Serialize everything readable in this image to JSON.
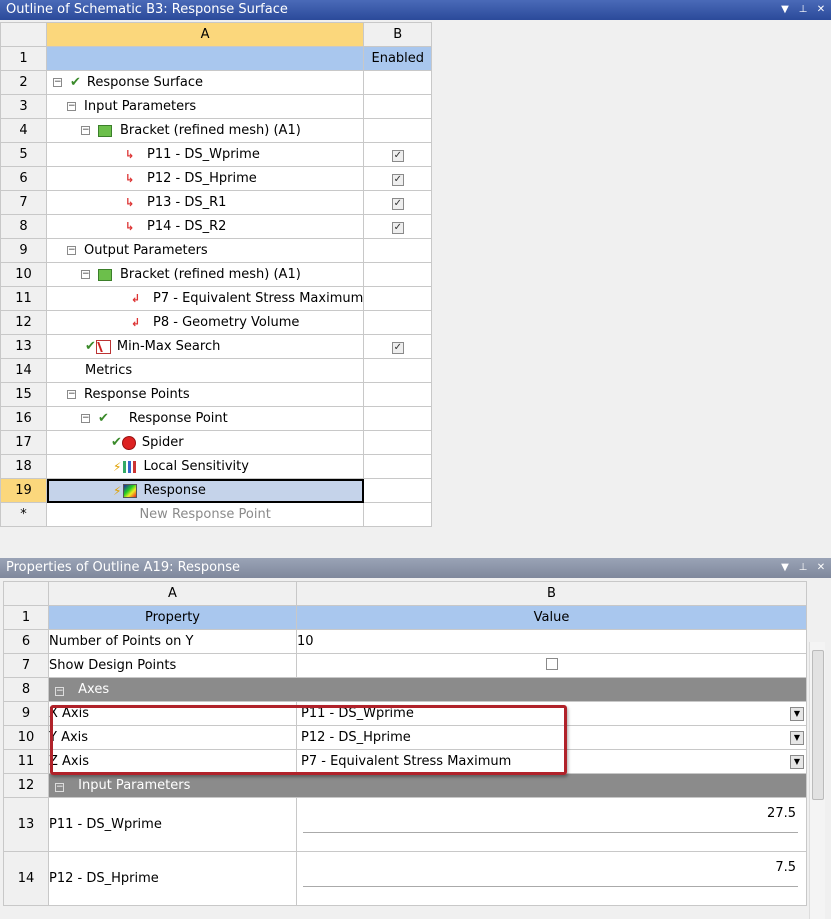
{
  "outline_panel": {
    "title": "Outline of Schematic B3: Response Surface",
    "col_a": "A",
    "col_b": "B",
    "enabled_header": "Enabled",
    "rows": [
      {
        "num": "1"
      },
      {
        "num": "2",
        "label": "Response Surface"
      },
      {
        "num": "3",
        "label": "Input Parameters"
      },
      {
        "num": "4",
        "label": "Bracket (refined mesh) (A1)"
      },
      {
        "num": "5",
        "label": "P11 - DS_Wprime"
      },
      {
        "num": "6",
        "label": "P12 - DS_Hprime"
      },
      {
        "num": "7",
        "label": "P13 - DS_R1"
      },
      {
        "num": "8",
        "label": "P14 - DS_R2"
      },
      {
        "num": "9",
        "label": "Output Parameters"
      },
      {
        "num": "10",
        "label": "Bracket (refined mesh) (A1)"
      },
      {
        "num": "11",
        "label": "P7 - Equivalent Stress Maximum"
      },
      {
        "num": "12",
        "label": "P8 - Geometry Volume"
      },
      {
        "num": "13",
        "label": "Min-Max Search"
      },
      {
        "num": "14",
        "label": "Metrics"
      },
      {
        "num": "15",
        "label": "Response Points"
      },
      {
        "num": "16",
        "label": "Response Point"
      },
      {
        "num": "17",
        "label": "Spider"
      },
      {
        "num": "18",
        "label": "Local Sensitivity"
      },
      {
        "num": "19",
        "label": "Response"
      },
      {
        "num": "*",
        "label": "New Response Point"
      }
    ]
  },
  "properties_panel": {
    "title": "Properties of Outline A19: Response",
    "col_a": "A",
    "col_b": "B",
    "header_property": "Property",
    "header_value": "Value",
    "rows": {
      "r1": {
        "num": "1"
      },
      "r6": {
        "num": "6",
        "prop": "Number of Points on Y",
        "value": "10"
      },
      "r7": {
        "num": "7",
        "prop": "Show Design Points"
      },
      "r8": {
        "num": "8",
        "group": "Axes"
      },
      "r9": {
        "num": "9",
        "prop": "X Axis",
        "value": "P11 - DS_Wprime"
      },
      "r10": {
        "num": "10",
        "prop": "Y Axis",
        "value": "P12 - DS_Hprime"
      },
      "r11": {
        "num": "11",
        "prop": "Z Axis",
        "value": "P7 - Equivalent Stress Maximum"
      },
      "r12": {
        "num": "12",
        "group": "Input Parameters"
      },
      "r13": {
        "num": "13",
        "prop": "P11 - DS_Wprime",
        "value": "27.5",
        "slider_fraction": 0.5
      },
      "r14": {
        "num": "14",
        "prop": "P12 - DS_Hprime",
        "value": "7.5",
        "slider_fraction": 0.5
      }
    }
  },
  "colors": {
    "title_active": "#2b4a9a",
    "header_selected": "#fbd77c",
    "header_blue": "#a9c7ee",
    "group_gray": "#8b8b8b",
    "highlight_red": "#b0222a"
  },
  "icons": {
    "pin": "pin-icon",
    "dropdown": "dropdown-icon",
    "close": "close-icon"
  }
}
